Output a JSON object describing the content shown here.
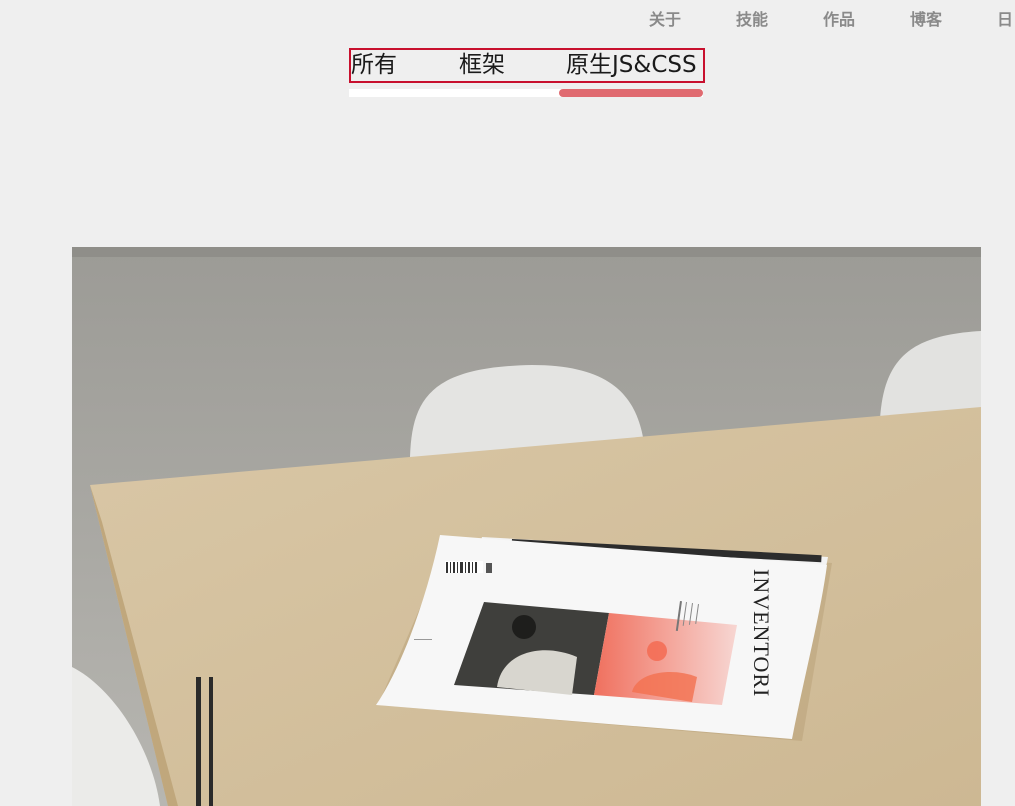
{
  "topnav": {
    "items": [
      {
        "label": "关于"
      },
      {
        "label": "技能"
      },
      {
        "label": "作品"
      },
      {
        "label": "博客"
      },
      {
        "label": "日"
      }
    ]
  },
  "filter": {
    "tabs": [
      {
        "label": "所有"
      },
      {
        "label": "框架"
      },
      {
        "label": "原生JS&CSS"
      }
    ],
    "active_index": 2,
    "accent_color": "#e06a70",
    "border_color": "#c8102e"
  },
  "photo": {
    "magazine_title": "INVENTORI"
  }
}
